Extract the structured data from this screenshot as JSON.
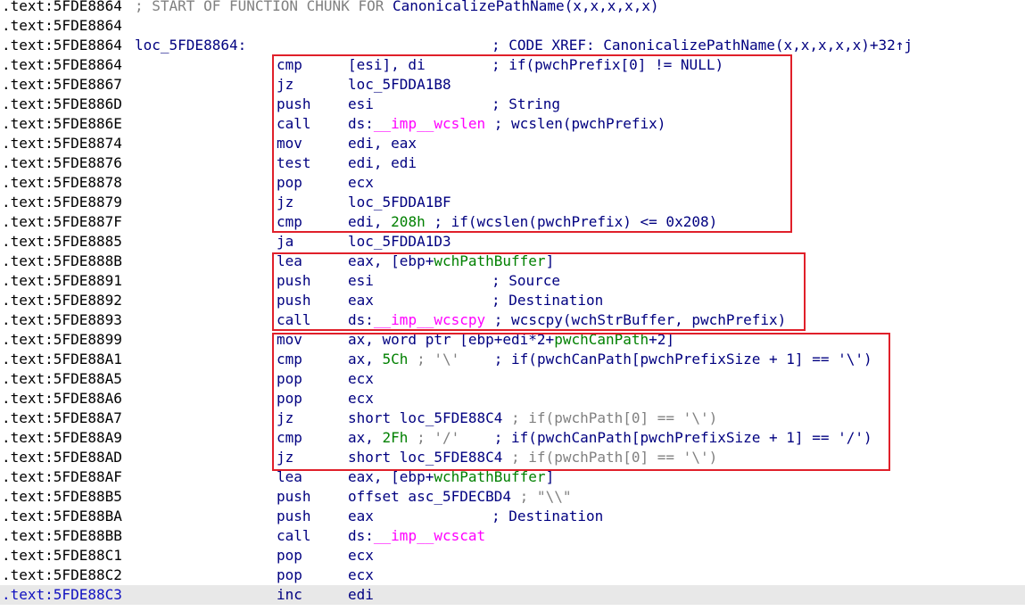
{
  "lines": [
    {
      "addr": ".text:5FDE8864",
      "chunk_prefix": "; START OF FUNCTION CHUNK FOR ",
      "chunk_func": "CanonicalizePathName(x,x,x,x,x)"
    },
    {
      "addr": ".text:5FDE8864"
    },
    {
      "addr": ".text:5FDE8864",
      "label": "loc_5FDE8864:",
      "xref": "; CODE XREF: CanonicalizePathName(x,x,x,x,x)+32↑j"
    },
    {
      "addr": ".text:5FDE8864",
      "mnem": "cmp",
      "operand": "[esi], di",
      "comment": "; if(pwchPrefix[0] != NULL)"
    },
    {
      "addr": ".text:5FDE8867",
      "mnem": "jz",
      "operand": "loc_5FDDA1B8"
    },
    {
      "addr": ".text:5FDE886D",
      "mnem": "push",
      "operand": "esi",
      "comment": "; String"
    },
    {
      "addr": ".text:5FDE886E",
      "mnem": "call",
      "op_pre": "ds:",
      "op_imp": "__imp__wcslen",
      "comment": "; wcslen(pwchPrefix)"
    },
    {
      "addr": ".text:5FDE8874",
      "mnem": "mov",
      "operand": "edi, eax"
    },
    {
      "addr": ".text:5FDE8876",
      "mnem": "test",
      "operand": "edi, edi"
    },
    {
      "addr": ".text:5FDE8878",
      "mnem": "pop",
      "operand": "ecx"
    },
    {
      "addr": ".text:5FDE8879",
      "mnem": "jz",
      "operand": "loc_5FDDA1BF"
    },
    {
      "addr": ".text:5FDE887F",
      "mnem": "cmp",
      "op_pre": "edi, ",
      "op_num": "208h",
      "comment": "; if(wcslen(pwchPrefix) <= 0x208)"
    },
    {
      "addr": ".text:5FDE8885",
      "mnem": "ja",
      "operand": "loc_5FDDA1D3"
    },
    {
      "addr": ".text:5FDE888B",
      "mnem": "lea",
      "op_pre": "eax, [ebp+",
      "op_var": "wchPathBuffer",
      "op_post": "]"
    },
    {
      "addr": ".text:5FDE8891",
      "mnem": "push",
      "operand": "esi",
      "comment": "; Source"
    },
    {
      "addr": ".text:5FDE8892",
      "mnem": "push",
      "operand": "eax",
      "comment": "; Destination"
    },
    {
      "addr": ".text:5FDE8893",
      "mnem": "call",
      "op_pre": "ds:",
      "op_imp": "__imp__wcscpy",
      "comment": "; wcscpy(wchStrBuffer, pwchPrefix)"
    },
    {
      "addr": ".text:5FDE8899",
      "mnem": "mov",
      "op_pre": "ax, word ptr [ebp+edi*2+",
      "op_var": "pwchCanPath",
      "op_post": "+2]"
    },
    {
      "addr": ".text:5FDE88A1",
      "mnem": "cmp",
      "op_pre": "ax, ",
      "op_num": "5Ch",
      "op_str": " ; '\\'",
      "comment": "   ; if(pwchCanPath[pwchPrefixSize + 1] == '\\')"
    },
    {
      "addr": ".text:5FDE88A5",
      "mnem": "pop",
      "operand": "ecx"
    },
    {
      "addr": ".text:5FDE88A6",
      "mnem": "pop",
      "operand": "ecx"
    },
    {
      "addr": ".text:5FDE88A7",
      "mnem": "jz",
      "operand": "short loc_5FDE88C4",
      "comment_gray": " ; if(pwchPath[0] == '\\')"
    },
    {
      "addr": ".text:5FDE88A9",
      "mnem": "cmp",
      "op_pre": "ax, ",
      "op_num": "2Fh",
      "op_str": " ; '/'",
      "comment": "   ; if(pwchCanPath[pwchPrefixSize + 1] == '/')"
    },
    {
      "addr": ".text:5FDE88AD",
      "mnem": "jz",
      "operand": "short loc_5FDE88C4",
      "comment_gray": " ; if(pwchPath[0] == '\\')"
    },
    {
      "addr": ".text:5FDE88AF",
      "mnem": "lea",
      "op_pre": "eax, [ebp+",
      "op_var": "wchPathBuffer",
      "op_post": "]"
    },
    {
      "addr": ".text:5FDE88B5",
      "mnem": "push",
      "operand": "offset asc_5FDECBD4",
      "op_str": " ; \"\\\\\""
    },
    {
      "addr": ".text:5FDE88BA",
      "mnem": "push",
      "operand": "eax",
      "comment": "; Destination"
    },
    {
      "addr": ".text:5FDE88BB",
      "mnem": "call",
      "op_pre": "ds:",
      "op_imp": "__imp__wcscat"
    },
    {
      "addr": ".text:5FDE88C1",
      "mnem": "pop",
      "operand": "ecx"
    },
    {
      "addr": ".text:5FDE88C2",
      "mnem": "pop",
      "operand": "ecx"
    },
    {
      "addr": ".text:5FDE88C3",
      "mnem": "inc",
      "operand": "edi",
      "highlight": true
    }
  ],
  "highlight_color": "#e0202a",
  "icons": [
    "xref-up-arrow"
  ]
}
